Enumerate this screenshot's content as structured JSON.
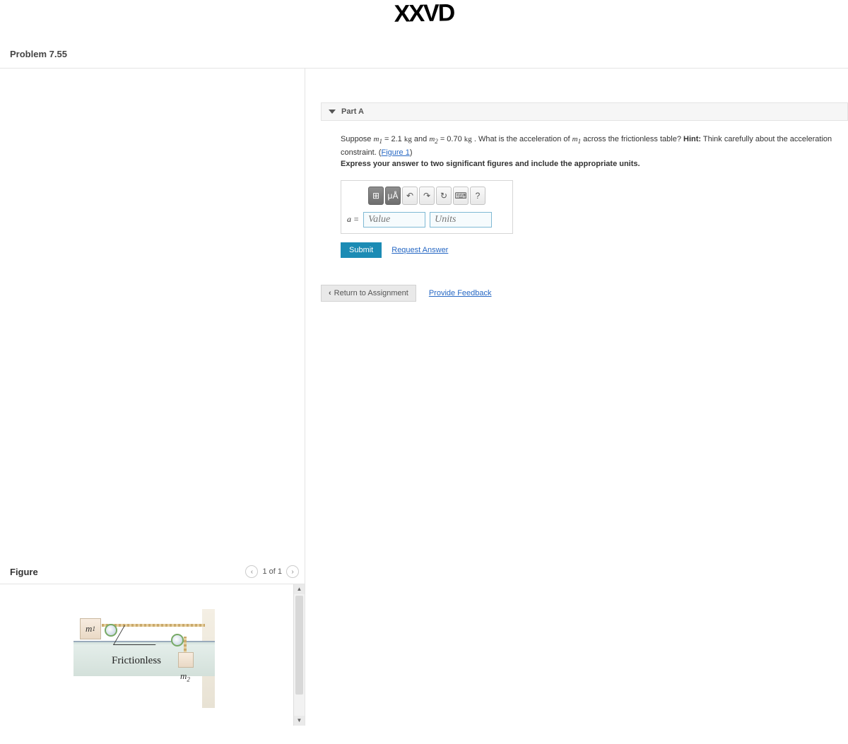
{
  "scribble": "XXVD",
  "problem_title": "Problem 7.55",
  "figure": {
    "title": "Figure",
    "pager": "1 of 1",
    "mass1_label": "m",
    "mass1_sub": "1",
    "mass2_label": "m",
    "mass2_sub": "2",
    "frictionless": "Frictionless"
  },
  "part": {
    "label": "Part A",
    "text_prefix": "Suppose ",
    "m1_val": " = 2.1 ",
    "kg1": "kg",
    "and": " and ",
    "m2_val": " = 0.70 ",
    "kg2": "kg",
    "period_q": " . What is the acceleration of ",
    "across": " across the frictionless table? ",
    "hint_label": "Hint:",
    "hint_text": " Think carefully about the acceleration constraint. (",
    "fig_link": "Figure 1",
    "close_paren": ")",
    "instruction": "Express your answer to two significant figures and include the appropriate units."
  },
  "answer": {
    "a_eq": "a =",
    "value_placeholder": "Value",
    "units_placeholder": "Units",
    "tools": {
      "templates": "⊞",
      "mu": "μÅ",
      "undo": "↶",
      "redo": "↷",
      "reset": "↻",
      "keyboard": "⌨",
      "help": "?"
    }
  },
  "actions": {
    "submit": "Submit",
    "request": "Request Answer",
    "return": "Return to Assignment",
    "feedback": "Provide Feedback"
  }
}
